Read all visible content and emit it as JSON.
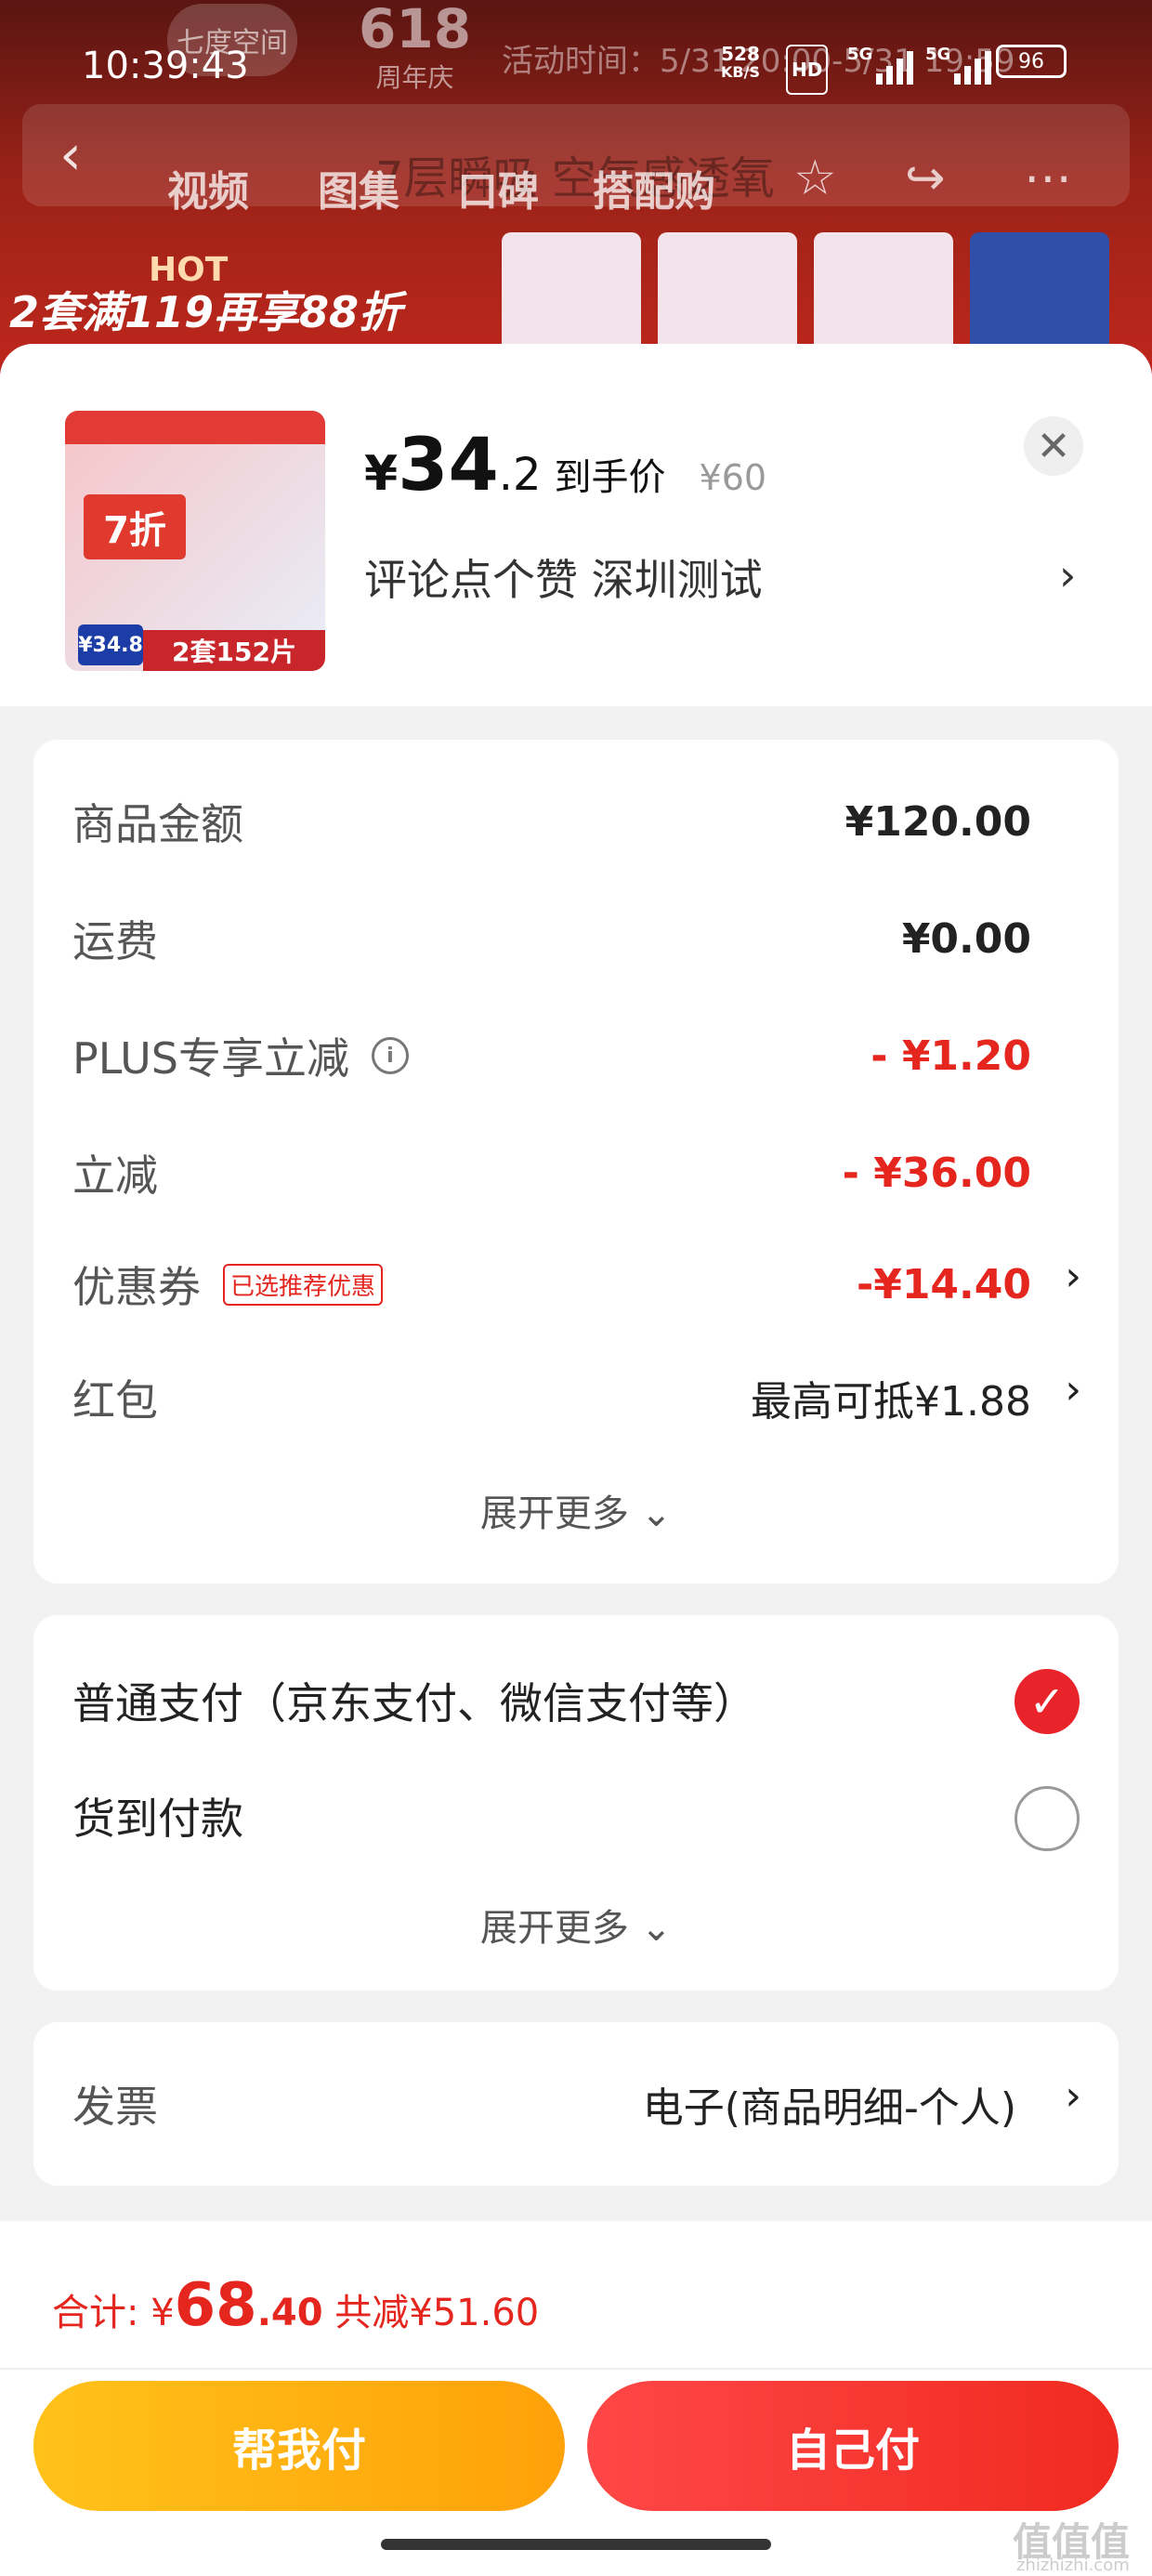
{
  "status_bar": {
    "time": "10:39:43",
    "net_speed_value": "528",
    "net_speed_unit": "KB/S",
    "hd_label": "HD",
    "net1": "5G",
    "net2": "5G",
    "battery": "96"
  },
  "background": {
    "anniversary_num": "618",
    "anniversary_text": "周年庆",
    "activity_text": "活动时间：5/31 20:00-5/31 19:59",
    "ghost_title": "7层瞬吸 空气感透氧",
    "hot_label": "HOT",
    "hot_promo": "2套满119再享88折"
  },
  "nav": {
    "tabs": [
      "视频",
      "图集",
      "口碑",
      "搭配购"
    ]
  },
  "product": {
    "thumb_discount": "7折",
    "thumb_price": "¥34.8",
    "thumb_pack": "2套152片",
    "currency": "¥",
    "price_int": "34",
    "price_dec": ".2",
    "price_label": "到手价",
    "original_price": "¥60",
    "spec": "评论点个赞  深圳测试"
  },
  "amounts": {
    "rows": [
      {
        "label": "商品金额",
        "value": "¥120.00"
      },
      {
        "label": "运费",
        "value": "¥0.00"
      },
      {
        "label": "PLUS专享立减",
        "value": "- ¥1.20"
      },
      {
        "label": "立减",
        "value": "- ¥36.00"
      },
      {
        "label": "优惠券",
        "tag": "已选推荐优惠",
        "value": "-¥14.40"
      },
      {
        "label": "红包",
        "value": "最高可抵¥1.88"
      }
    ],
    "more": "展开更多"
  },
  "payment": {
    "options": [
      {
        "label": "普通支付（京东支付、微信支付等）",
        "selected": true
      },
      {
        "label": "货到付款",
        "selected": false
      }
    ],
    "more": "展开更多"
  },
  "invoice": {
    "label": "发票",
    "value": "电子(商品明细-个人)"
  },
  "footer": {
    "total_prefix": "合计: ¥",
    "total_int": "68",
    "total_dec": ".40",
    "saved": " 共减¥51.60",
    "help_pay": "帮我付",
    "self_pay": "自己付",
    "watermark": "值值值",
    "watermark_site": "zhizhizhi.com"
  },
  "colors": {
    "accent_red": "#e5261f",
    "help_btn": "#ffb10f",
    "self_btn": "#f53a30"
  }
}
